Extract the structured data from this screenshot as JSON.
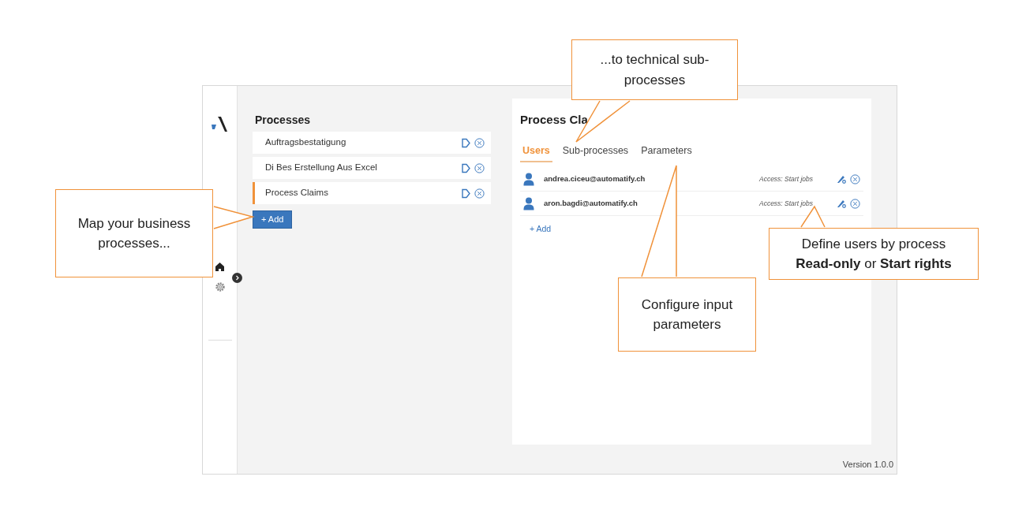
{
  "sidebar": {
    "nav_items": [
      {
        "kind": "home",
        "selected": true
      },
      {
        "kind": "settings",
        "selected": false
      }
    ]
  },
  "processes": {
    "title": "Processes",
    "items": [
      {
        "name": "Auftragsbestatigung",
        "selected": false
      },
      {
        "name": "Di Bes Erstellung Aus Excel",
        "selected": false
      },
      {
        "name": "Process Claims",
        "selected": true
      }
    ],
    "add_button": "+ Add"
  },
  "detail": {
    "title": "Process Cla",
    "tabs": [
      {
        "label": "Users",
        "selected": true
      },
      {
        "label": "Sub-processes",
        "selected": false
      },
      {
        "label": "Parameters",
        "selected": false
      }
    ],
    "users": [
      {
        "email": "andrea.ciceu@automatify.ch",
        "access": "Access: Start jobs"
      },
      {
        "email": "aron.bagdi@automatify.ch",
        "access": "Access: Start jobs"
      }
    ],
    "add_link": "+ Add"
  },
  "version": "Version 1.0.0",
  "callouts": [
    {
      "lines": [
        "...to technical sub-",
        "processes"
      ]
    },
    {
      "lines": [
        "Map your business",
        "processes..."
      ]
    },
    {
      "lines": [
        "Define users by process",
        "**Read-only** or **Start rights**"
      ]
    },
    {
      "lines": [
        "Configure input",
        "parameters"
      ]
    }
  ]
}
